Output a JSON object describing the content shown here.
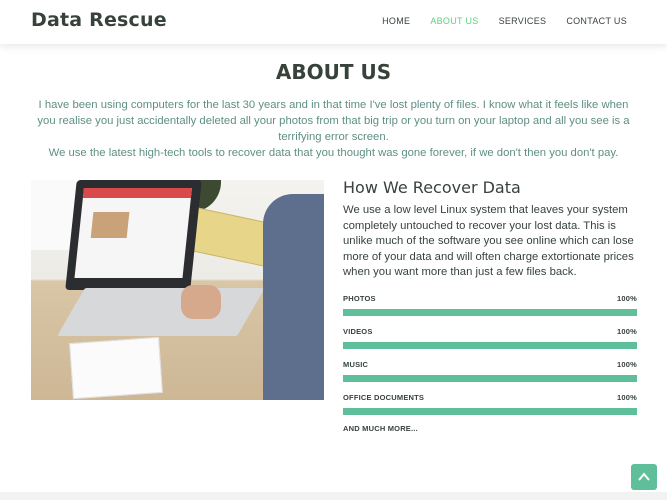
{
  "header": {
    "brand": "Data Rescue",
    "nav": [
      {
        "label": "HOME",
        "active": false
      },
      {
        "label": "ABOUT US",
        "active": true
      },
      {
        "label": "SERVICES",
        "active": false
      },
      {
        "label": "CONTACT US",
        "active": false
      }
    ]
  },
  "about": {
    "title": "ABOUT US",
    "intro_1": "I have been using computers for the last 30 years and in that time I've lost plenty of files. I know what it feels like when you realise you just accidentally deleted all your photos from that big trip or you turn on your laptop and all you see is a terrifying error screen.",
    "intro_2": "We use the latest high-tech tools to recover data that you thought was gone forever, if we don't then you don't pay."
  },
  "recover": {
    "heading": "How We Recover Data",
    "body": "We use a low level Linux system that leaves your system completely untouched to recover your lost data. This is unlike much of the software you see online which can lose more of your data and will often charge extortionate prices when you want more than just a few files back."
  },
  "skills": [
    {
      "label": "PHOTOS",
      "percent_label": "100%",
      "level": 100
    },
    {
      "label": "VIDEOS",
      "percent_label": "100%",
      "level": 100
    },
    {
      "label": "MUSIC",
      "percent_label": "100%",
      "level": 100
    },
    {
      "label": "OFFICE DOCUMENTS",
      "percent_label": "100%",
      "level": 100
    }
  ],
  "more_label": "AND MUCH MORE...",
  "icons": {
    "back_to_top": "arrow-up-icon"
  },
  "colors": {
    "accent": "#5fcf80",
    "bar": "#5fbf9b",
    "text_dark": "#37423b",
    "intro_text": "#5f8f84"
  }
}
